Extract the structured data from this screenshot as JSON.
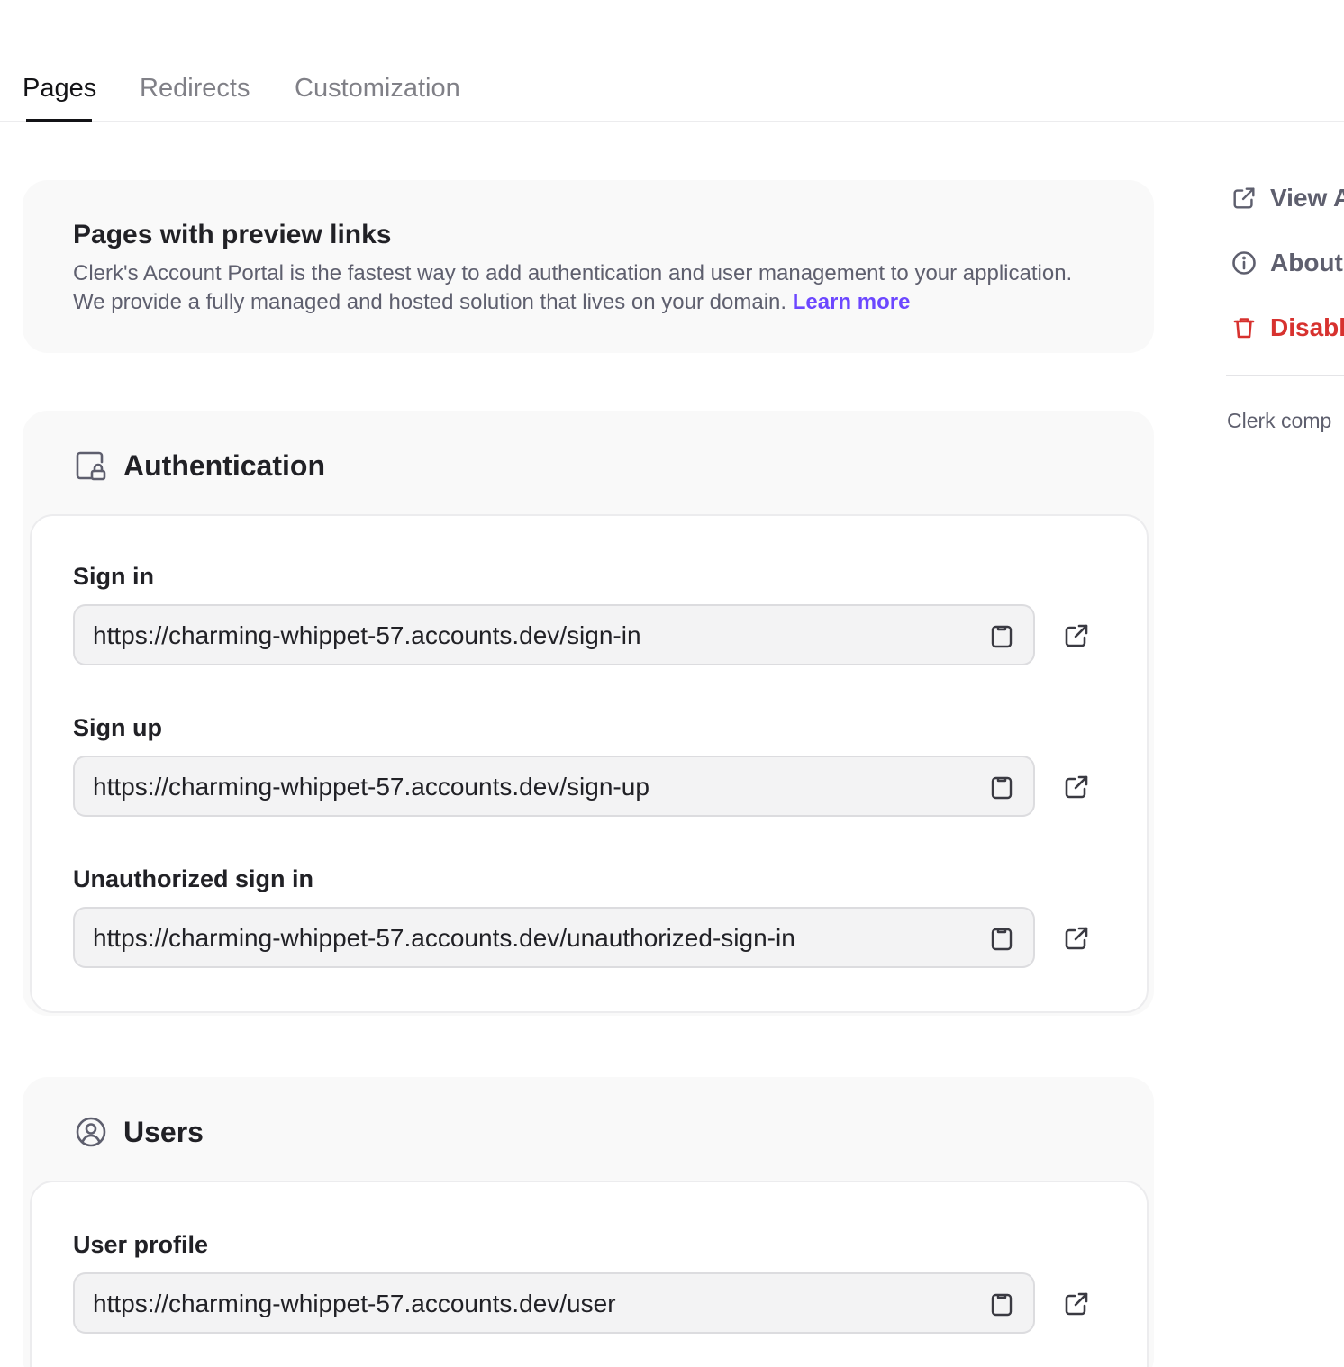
{
  "tabs": [
    {
      "label": "Pages",
      "active": true
    },
    {
      "label": "Redirects",
      "active": false
    },
    {
      "label": "Customization",
      "active": false
    }
  ],
  "intro": {
    "title": "Pages with preview links",
    "text": "Clerk's Account Portal is the fastest way to add authentication and user management to your application. We provide a fully managed and hosted solution that lives on your domain. ",
    "link": "Learn more"
  },
  "sections": {
    "authentication": {
      "title": "Authentication",
      "icon": "lock-page-icon",
      "fields": [
        {
          "label": "Sign in",
          "url": "https://charming-whippet-57.accounts.dev/sign-in"
        },
        {
          "label": "Sign up",
          "url": "https://charming-whippet-57.accounts.dev/sign-up"
        },
        {
          "label": "Unauthorized sign in",
          "url": "https://charming-whippet-57.accounts.dev/unauthorized-sign-in"
        }
      ]
    },
    "users": {
      "title": "Users",
      "icon": "user-circle-icon",
      "fields": [
        {
          "label": "User profile",
          "url": "https://charming-whippet-57.accounts.dev/user"
        }
      ]
    }
  },
  "sidebar": {
    "items": [
      {
        "label": "View A",
        "icon": "external-link-icon"
      },
      {
        "label": "About",
        "icon": "info-icon"
      },
      {
        "label": "Disabl",
        "icon": "trash-icon",
        "color": "#d7322f"
      }
    ],
    "note": "Clerk comp"
  },
  "colors": {
    "accent": "#6c47ff",
    "danger": "#d7322f",
    "card_bg": "#f9f9f9",
    "input_bg": "#f3f3f4"
  }
}
